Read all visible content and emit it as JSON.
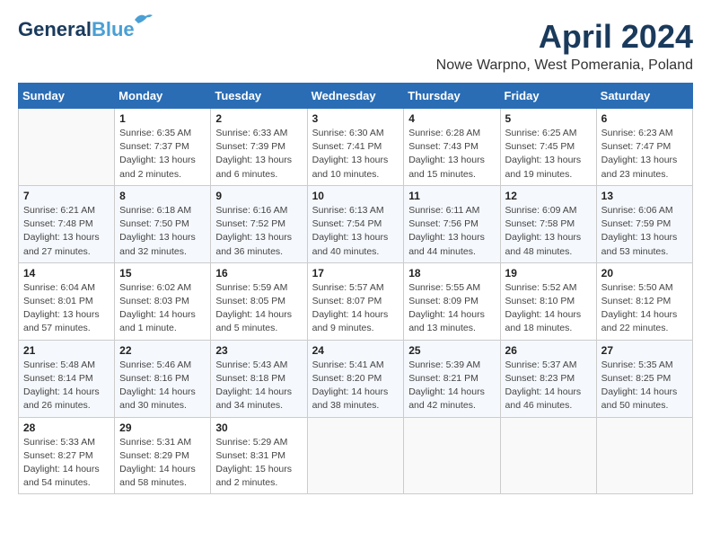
{
  "header": {
    "logo_general": "General",
    "logo_blue": "Blue",
    "month": "April 2024",
    "location": "Nowe Warpno, West Pomerania, Poland"
  },
  "weekdays": [
    "Sunday",
    "Monday",
    "Tuesday",
    "Wednesday",
    "Thursday",
    "Friday",
    "Saturday"
  ],
  "weeks": [
    [
      {
        "day": "",
        "info": ""
      },
      {
        "day": "1",
        "info": "Sunrise: 6:35 AM\nSunset: 7:37 PM\nDaylight: 13 hours\nand 2 minutes."
      },
      {
        "day": "2",
        "info": "Sunrise: 6:33 AM\nSunset: 7:39 PM\nDaylight: 13 hours\nand 6 minutes."
      },
      {
        "day": "3",
        "info": "Sunrise: 6:30 AM\nSunset: 7:41 PM\nDaylight: 13 hours\nand 10 minutes."
      },
      {
        "day": "4",
        "info": "Sunrise: 6:28 AM\nSunset: 7:43 PM\nDaylight: 13 hours\nand 15 minutes."
      },
      {
        "day": "5",
        "info": "Sunrise: 6:25 AM\nSunset: 7:45 PM\nDaylight: 13 hours\nand 19 minutes."
      },
      {
        "day": "6",
        "info": "Sunrise: 6:23 AM\nSunset: 7:47 PM\nDaylight: 13 hours\nand 23 minutes."
      }
    ],
    [
      {
        "day": "7",
        "info": "Sunrise: 6:21 AM\nSunset: 7:48 PM\nDaylight: 13 hours\nand 27 minutes."
      },
      {
        "day": "8",
        "info": "Sunrise: 6:18 AM\nSunset: 7:50 PM\nDaylight: 13 hours\nand 32 minutes."
      },
      {
        "day": "9",
        "info": "Sunrise: 6:16 AM\nSunset: 7:52 PM\nDaylight: 13 hours\nand 36 minutes."
      },
      {
        "day": "10",
        "info": "Sunrise: 6:13 AM\nSunset: 7:54 PM\nDaylight: 13 hours\nand 40 minutes."
      },
      {
        "day": "11",
        "info": "Sunrise: 6:11 AM\nSunset: 7:56 PM\nDaylight: 13 hours\nand 44 minutes."
      },
      {
        "day": "12",
        "info": "Sunrise: 6:09 AM\nSunset: 7:58 PM\nDaylight: 13 hours\nand 48 minutes."
      },
      {
        "day": "13",
        "info": "Sunrise: 6:06 AM\nSunset: 7:59 PM\nDaylight: 13 hours\nand 53 minutes."
      }
    ],
    [
      {
        "day": "14",
        "info": "Sunrise: 6:04 AM\nSunset: 8:01 PM\nDaylight: 13 hours\nand 57 minutes."
      },
      {
        "day": "15",
        "info": "Sunrise: 6:02 AM\nSunset: 8:03 PM\nDaylight: 14 hours\nand 1 minute."
      },
      {
        "day": "16",
        "info": "Sunrise: 5:59 AM\nSunset: 8:05 PM\nDaylight: 14 hours\nand 5 minutes."
      },
      {
        "day": "17",
        "info": "Sunrise: 5:57 AM\nSunset: 8:07 PM\nDaylight: 14 hours\nand 9 minutes."
      },
      {
        "day": "18",
        "info": "Sunrise: 5:55 AM\nSunset: 8:09 PM\nDaylight: 14 hours\nand 13 minutes."
      },
      {
        "day": "19",
        "info": "Sunrise: 5:52 AM\nSunset: 8:10 PM\nDaylight: 14 hours\nand 18 minutes."
      },
      {
        "day": "20",
        "info": "Sunrise: 5:50 AM\nSunset: 8:12 PM\nDaylight: 14 hours\nand 22 minutes."
      }
    ],
    [
      {
        "day": "21",
        "info": "Sunrise: 5:48 AM\nSunset: 8:14 PM\nDaylight: 14 hours\nand 26 minutes."
      },
      {
        "day": "22",
        "info": "Sunrise: 5:46 AM\nSunset: 8:16 PM\nDaylight: 14 hours\nand 30 minutes."
      },
      {
        "day": "23",
        "info": "Sunrise: 5:43 AM\nSunset: 8:18 PM\nDaylight: 14 hours\nand 34 minutes."
      },
      {
        "day": "24",
        "info": "Sunrise: 5:41 AM\nSunset: 8:20 PM\nDaylight: 14 hours\nand 38 minutes."
      },
      {
        "day": "25",
        "info": "Sunrise: 5:39 AM\nSunset: 8:21 PM\nDaylight: 14 hours\nand 42 minutes."
      },
      {
        "day": "26",
        "info": "Sunrise: 5:37 AM\nSunset: 8:23 PM\nDaylight: 14 hours\nand 46 minutes."
      },
      {
        "day": "27",
        "info": "Sunrise: 5:35 AM\nSunset: 8:25 PM\nDaylight: 14 hours\nand 50 minutes."
      }
    ],
    [
      {
        "day": "28",
        "info": "Sunrise: 5:33 AM\nSunset: 8:27 PM\nDaylight: 14 hours\nand 54 minutes."
      },
      {
        "day": "29",
        "info": "Sunrise: 5:31 AM\nSunset: 8:29 PM\nDaylight: 14 hours\nand 58 minutes."
      },
      {
        "day": "30",
        "info": "Sunrise: 5:29 AM\nSunset: 8:31 PM\nDaylight: 15 hours\nand 2 minutes."
      },
      {
        "day": "",
        "info": ""
      },
      {
        "day": "",
        "info": ""
      },
      {
        "day": "",
        "info": ""
      },
      {
        "day": "",
        "info": ""
      }
    ]
  ]
}
